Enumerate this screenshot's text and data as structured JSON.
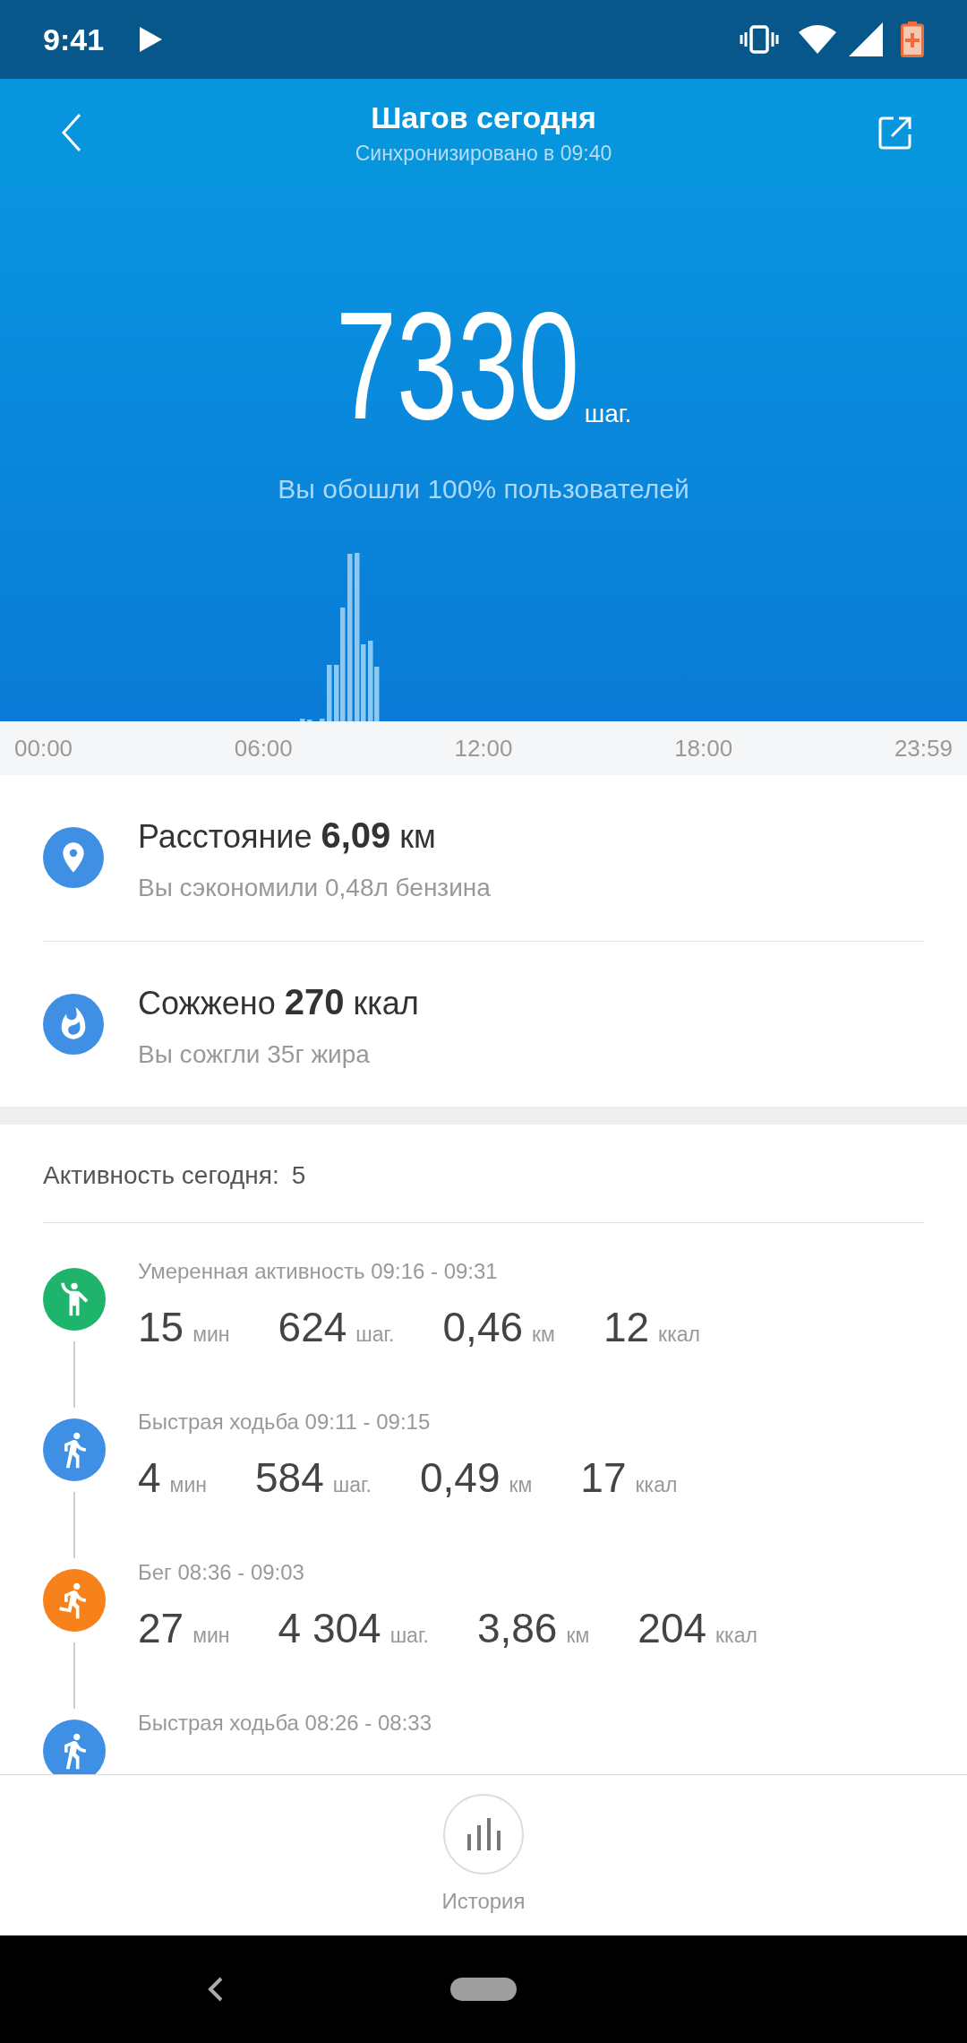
{
  "status_bar": {
    "time": "9:41"
  },
  "header": {
    "title": "Шагов сегодня",
    "subtitle": "Синхронизировано в 09:40"
  },
  "summary": {
    "steps": "7330",
    "unit": "шаг.",
    "comparison": "Вы обошли 100% пользователей"
  },
  "chart_axis": [
    "00:00",
    "06:00",
    "12:00",
    "18:00",
    "23:59"
  ],
  "metrics": [
    {
      "kind": "distance",
      "text": "Расстояние **6,09** км",
      "note": "Вы сэкономили 0,48л бензина"
    },
    {
      "kind": "calories",
      "text": "Сожжено **270** ккал",
      "note": "Вы сожгли 35г жира"
    }
  ],
  "activity": {
    "label": "Активность сегодня:",
    "count": "5",
    "items": [
      {
        "kind": "moderate",
        "title": "Умеренная активность 09:16 - 09:31",
        "stats": [
          {
            "value": "15",
            "unit": "мин"
          },
          {
            "value": "624",
            "unit": "шаг."
          },
          {
            "value": "0,46",
            "unit": "км"
          },
          {
            "value": "12",
            "unit": "ккал"
          }
        ]
      },
      {
        "kind": "walk",
        "title": "Быстрая ходьба 09:11 - 09:15",
        "stats": [
          {
            "value": "4",
            "unit": "мин"
          },
          {
            "value": "584",
            "unit": "шаг."
          },
          {
            "value": "0,49",
            "unit": "км"
          },
          {
            "value": "17",
            "unit": "ккал"
          }
        ]
      },
      {
        "kind": "run",
        "title": "Бег 08:36 - 09:03",
        "stats": [
          {
            "value": "27",
            "unit": "мин"
          },
          {
            "value": "4 304",
            "unit": "шаг."
          },
          {
            "value": "3,86",
            "unit": "км"
          },
          {
            "value": "204",
            "unit": "ккал"
          }
        ]
      },
      {
        "kind": "walk",
        "title": "Быстрая ходьба 08:26 - 08:33"
      }
    ]
  },
  "bottom_nav": {
    "label": "История"
  }
}
